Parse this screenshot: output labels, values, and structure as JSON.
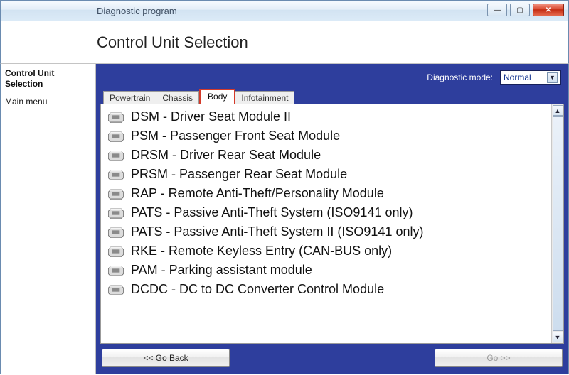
{
  "window": {
    "title": "Diagnostic program",
    "ghost_left": ""
  },
  "header": {
    "page_title": "Control Unit Selection"
  },
  "sidebar": {
    "items": [
      {
        "label": "Control Unit Selection",
        "bold": true
      },
      {
        "label": "Main menu",
        "bold": false
      }
    ]
  },
  "mode": {
    "label": "Diagnostic mode:",
    "selected": "Normal"
  },
  "tabs": [
    {
      "label": "Powertrain",
      "active": false
    },
    {
      "label": "Chassis",
      "active": false
    },
    {
      "label": "Body",
      "active": true
    },
    {
      "label": "Infotainment",
      "active": false
    }
  ],
  "list": [
    {
      "label": "DSM - Driver Seat Module II"
    },
    {
      "label": "PSM - Passenger Front Seat Module"
    },
    {
      "label": "DRSM - Driver Rear Seat Module"
    },
    {
      "label": "PRSM - Passenger Rear Seat Module"
    },
    {
      "label": "RAP - Remote Anti-Theft/Personality Module"
    },
    {
      "label": "PATS - Passive Anti-Theft System (ISO9141 only)"
    },
    {
      "label": "PATS - Passive Anti-Theft System II (ISO9141 only)"
    },
    {
      "label": "RKE - Remote Keyless Entry (CAN-BUS only)"
    },
    {
      "label": "PAM - Parking assistant module"
    },
    {
      "label": "DCDC - DC to DC Converter Control Module"
    }
  ],
  "nav": {
    "back": "<< Go Back",
    "next": "Go >>"
  }
}
